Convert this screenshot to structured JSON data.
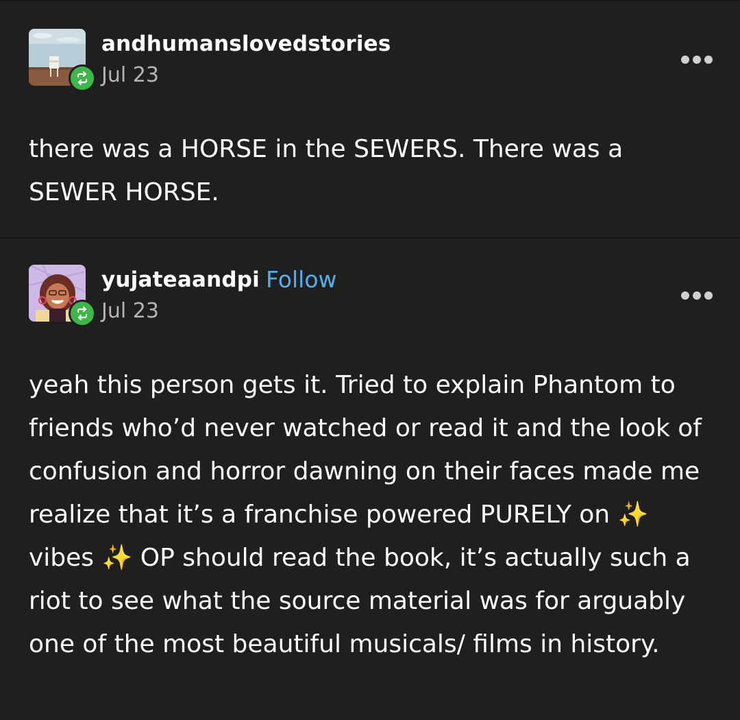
{
  "posts": [
    {
      "username": "andhumanslovedstories",
      "date": "Jul 23",
      "text": "there was a HORSE in the SEWERS. There was a SEWER HORSE."
    },
    {
      "username": "yujateaandpi",
      "follow_label": "Follow",
      "date": "Jul 23",
      "text": "yeah this person gets it. Tried to explain Phantom to friends who’d never watched or read it and the look of confusion and horror dawning on their faces made me realize that it’s a franchise powered PURELY on ✨ vibes ✨ OP should read the book, it’s actually such a riot to see what the source material was for arguably one of the most beautiful musicals/ films in history."
    }
  ],
  "icons": {
    "reblog": "reblog-icon",
    "more": "more-horizontal-icon"
  },
  "colors": {
    "background": "#1f1f1f",
    "follow": "#4fb0f2",
    "reblog_badge": "#3fb64a"
  }
}
